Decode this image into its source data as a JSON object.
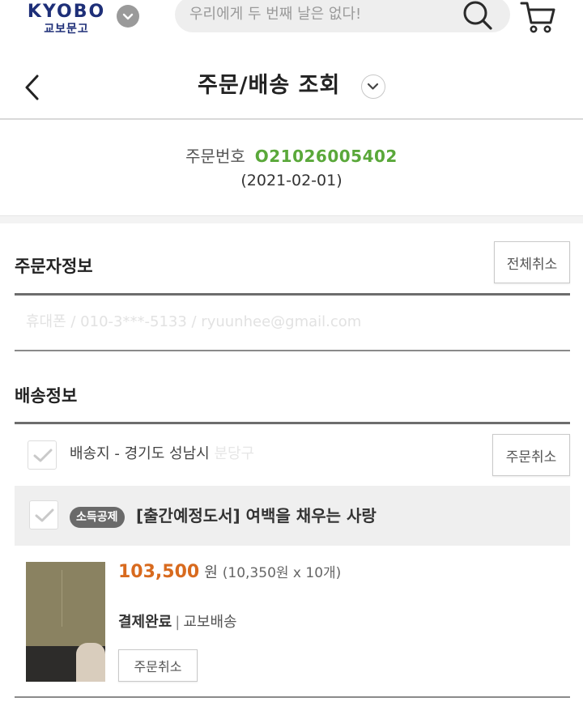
{
  "brand": {
    "name_en": "KYOBO",
    "name_ko": "교보문고"
  },
  "search": {
    "placeholder": "우리에게 두 번째 날은 없다!"
  },
  "header": {
    "title": "주문/배송 조회"
  },
  "order": {
    "number_label": "주문번호",
    "number": "O21026005402",
    "date": "(2021-02-01)"
  },
  "orderer": {
    "title": "주문자정보",
    "cancel_all_label": "전체취소",
    "contact_text": "휴대폰 / 010-3***-5133 / ryuunhee@gmail.com"
  },
  "shipping": {
    "title": "배송정보",
    "address_label": "배송지 - 경기도 성남시",
    "address_faded": "분당구",
    "cancel_label": "주문취소"
  },
  "product": {
    "badge": "소득공제",
    "title": "[출간예정도서] 여백을 채우는 사랑",
    "price": "103,500",
    "price_unit": "원",
    "price_detail": "(10,350원 x 10개)",
    "payment_status": "결제완료",
    "delivery": "교보배송",
    "cancel_label": "주문취소"
  },
  "colors": {
    "brand": "#1e2f78",
    "order_number": "#5aa83a",
    "price": "#d86a1e"
  }
}
